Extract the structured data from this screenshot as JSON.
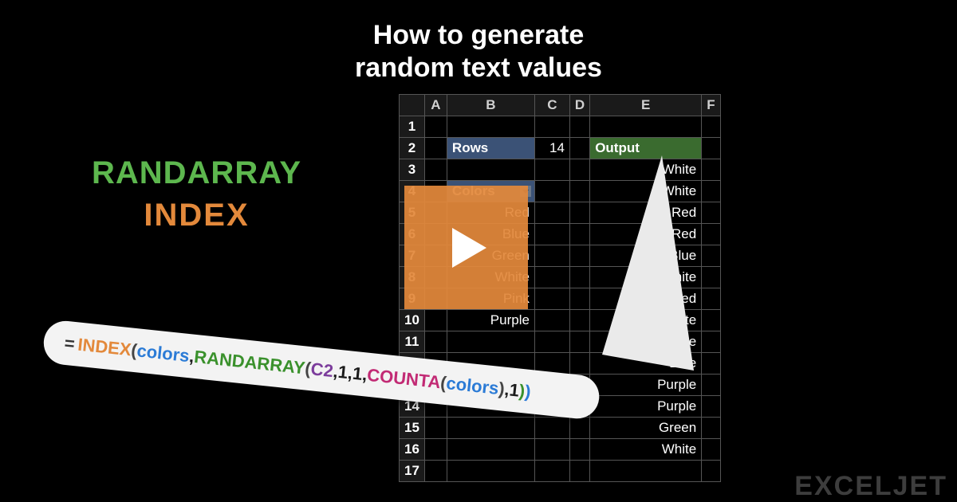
{
  "title": {
    "line1": "How to generate",
    "line2": "random text values"
  },
  "functions": {
    "randarray": "RANDARRAY",
    "index": "INDEX"
  },
  "table": {
    "columns": [
      "A",
      "B",
      "C",
      "D",
      "E",
      "F"
    ],
    "rows_label": "Rows",
    "rows_value": "14",
    "colors_label": "Colors",
    "output_label": "Output",
    "color_list": [
      "Red",
      "Blue",
      "Green",
      "White",
      "Pink",
      "Purple"
    ],
    "output_list": [
      "White",
      "White",
      "Red",
      "Red",
      "Blue",
      "White",
      "Red",
      "White",
      "White",
      "Blue",
      "Purple",
      "Purple",
      "Green",
      "White"
    ]
  },
  "formula": {
    "eq": "=",
    "index": "INDEX",
    "lp1": "(",
    "name1": "colors",
    "c1": ",",
    "rand": "RANDARRAY",
    "lp2": "(",
    "ref": "C2",
    "c2": ",",
    "n1": "1",
    "c3": ",",
    "n2": "1",
    "c4": ",",
    "counta": "COUNTA",
    "lp3": "(",
    "name2": "colors",
    "rp3": ")",
    "c5": ",",
    "n3": "1",
    "rp2": ")",
    "rp1": ")"
  },
  "watermark": "EXCELJET"
}
